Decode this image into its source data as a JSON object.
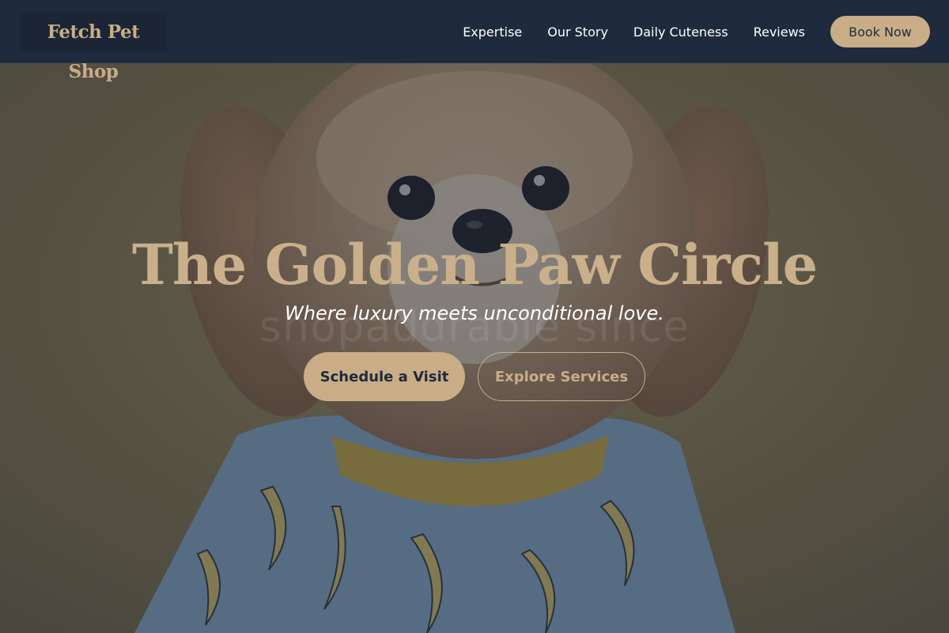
{
  "brand": {
    "name": "Fetch Pet Shop"
  },
  "nav": {
    "links": [
      "Expertise",
      "Our Story",
      "Daily Cuteness",
      "Reviews"
    ],
    "cta_label": "Book Now"
  },
  "hero": {
    "title": "The Golden Paw Circle",
    "subtitle": "Where luxury meets unconditional love.",
    "ghost_text": "shopaddrable since",
    "primary_button": "Schedule a Visit",
    "secondary_button": "Explore Services",
    "image": "fluffy-puppy-in-banana-shirt"
  },
  "colors": {
    "navy": "#1f2a3d",
    "gold": "#c9ad86",
    "white": "#ffffff"
  }
}
